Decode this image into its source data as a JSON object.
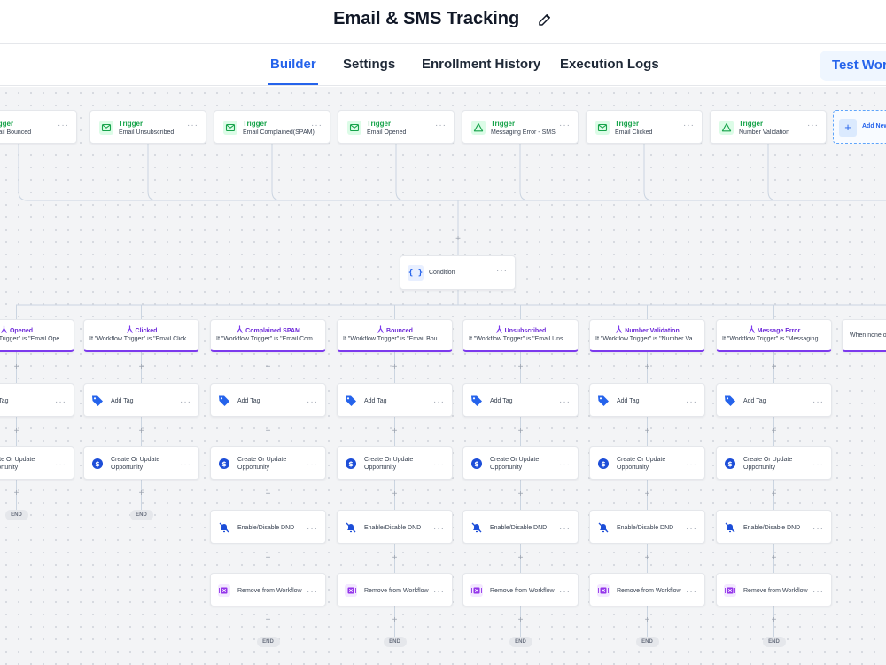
{
  "header": {
    "title": "Email & SMS Tracking"
  },
  "tabs": [
    {
      "label": "Builder",
      "active": true
    },
    {
      "label": "Settings"
    },
    {
      "label": "Enrollment History"
    },
    {
      "label": "Execution Logs"
    }
  ],
  "test_button": {
    "label": "Test Work"
  },
  "triggers": [
    {
      "label": "Trigger",
      "value": "Email Bounced",
      "icon": "mail-icon"
    },
    {
      "label": "Trigger",
      "value": "Email Unsubscribed",
      "icon": "mail-icon"
    },
    {
      "label": "Trigger",
      "value": "Email Complained(SPAM)",
      "icon": "mail-icon"
    },
    {
      "label": "Trigger",
      "value": "Email Opened",
      "icon": "mail-icon"
    },
    {
      "label": "Trigger",
      "value": "Messaging Error - SMS",
      "icon": "alert-triangle-icon"
    },
    {
      "label": "Trigger",
      "value": "Email Clicked",
      "icon": "mail-icon"
    },
    {
      "label": "Trigger",
      "value": "Number Validation",
      "icon": "alert-triangle-icon"
    }
  ],
  "add_trigger": {
    "label": "Add New"
  },
  "condition": {
    "label": "Condition",
    "icon": "braces-icon"
  },
  "branches": [
    {
      "name": "Opened",
      "condition": "If \"Workflow Trigger\" is \"Email Opened\""
    },
    {
      "name": "Clicked",
      "condition": "If \"Workflow Trigger\" is \"Email Clicked\""
    },
    {
      "name": "Complained SPAM",
      "condition": "If \"Workflow Trigger\" is \"Email Compl..."
    },
    {
      "name": "Bounced",
      "condition": "If \"Workflow Trigger\" is \"Email Bounced\""
    },
    {
      "name": "Unsubscribed",
      "condition": "If \"Workflow Trigger\" is \"Email Unsub..."
    },
    {
      "name": "Number Validation",
      "condition": "If \"Workflow Trigger\" is \"Number Vali..."
    },
    {
      "name": "Message Error",
      "condition": "If \"Workflow Trigger\" is \"Messaging E..."
    },
    {
      "name": "",
      "condition": "When none o"
    }
  ],
  "actions": {
    "add_tag": "Add Tag",
    "create_opportunity": [
      "Create Or Update",
      "Opportunity"
    ],
    "dnd": "Enable/Disable DND",
    "remove": "Remove from Workflow"
  },
  "end_label": "END",
  "colors": {
    "accent": "#2563eb",
    "trigger_green": "#16a34a",
    "branch_purple": "#7c3aed",
    "canvas_bg": "#f3f4f6"
  }
}
